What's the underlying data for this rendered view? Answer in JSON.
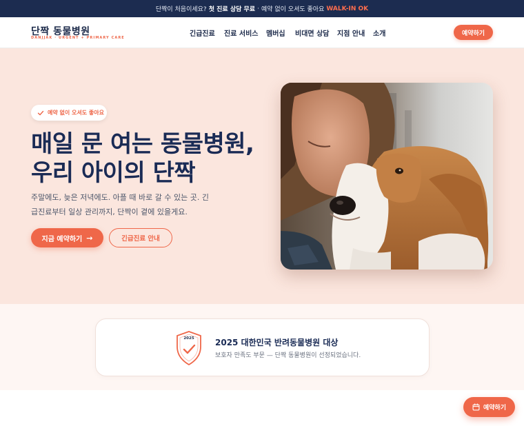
{
  "announcement": {
    "part1": "단짝이 처음이세요?",
    "part2": "첫 진료 상담 무료",
    "sep": "·",
    "part3": "예약 없이 오셔도 좋아요",
    "part4": "WALK-IN OK"
  },
  "brand": {
    "name": "단짝 동물병원",
    "tagline": "DANJJAK · URGENT + PRIMARY CARE"
  },
  "nav": {
    "items": [
      {
        "label": "긴급진료"
      },
      {
        "label": "진료 서비스"
      },
      {
        "label": "멤버십"
      },
      {
        "label": "비대면 상담"
      },
      {
        "label": "지점 안내"
      },
      {
        "label": "소개"
      }
    ],
    "cta_label": "예약하기"
  },
  "hero": {
    "badge": "예약 없이 오셔도 좋아요",
    "title_line1": "매일 문 여는 동물병원,",
    "title_line2": "우리 아이의 단짝",
    "description": "주말에도, 늦은 저녁에도. 아플 때 바로 갈 수 있는 곳. 긴급진료부터 일상 관리까지, 단짝이 곁에 있을게요.",
    "primary_button": "지금 예약하기",
    "primary_arrow": "→",
    "secondary_button": "긴급진료 안내"
  },
  "award": {
    "year": "2025",
    "title": "2025 대한민국 반려동물병원 대상",
    "subtitle": "보호자 만족도 부문 — 단짝 동물병원이 선정되었습니다."
  },
  "floating": {
    "label": "예약하기",
    "icon": "calendar-icon"
  },
  "colors": {
    "accent": "#ef6749",
    "navy": "#1c2c50",
    "hero_bg": "#fbe6de"
  }
}
